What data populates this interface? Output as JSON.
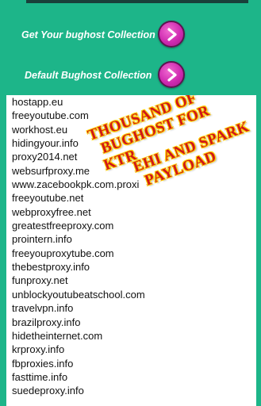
{
  "colors": {
    "background": "#1db589",
    "button": "#cf2bb1",
    "overlay_text": "#d01818",
    "overlay_outline": "#ffd200"
  },
  "actions": [
    {
      "label": "Get Your bughost Collection",
      "icon": "chevron-right-icon"
    },
    {
      "label": "Default Bughost Collection",
      "icon": "chevron-right-icon"
    }
  ],
  "hosts": [
    "hostapp.eu",
    "freeyoutube.com",
    "workhost.eu",
    "hidingyour.info",
    "proxy2014.net",
    "websurfproxy.me",
    "www.zacebookpk.com.proxi",
    "freeyoutube.net",
    "webproxyfree.net",
    "greatestfreeproxy.com",
    "prointern.info",
    "freeyouproxytube.com",
    "thebestproxy.info",
    "funproxy.net",
    "unblockyoutubeatschool.com",
    "travelvpn.info",
    "brazilproxy.info",
    "hidetheinternet.com",
    "krproxy.info",
    "fbproxies.info",
    "fasttime.info",
    "suedeproxy.info"
  ],
  "overlay": {
    "lines": [
      "THOUSAND OF",
      "BUGHOST FOR",
      "KTR",
      "EHI AND SPARK",
      "PAYLOAD"
    ]
  }
}
